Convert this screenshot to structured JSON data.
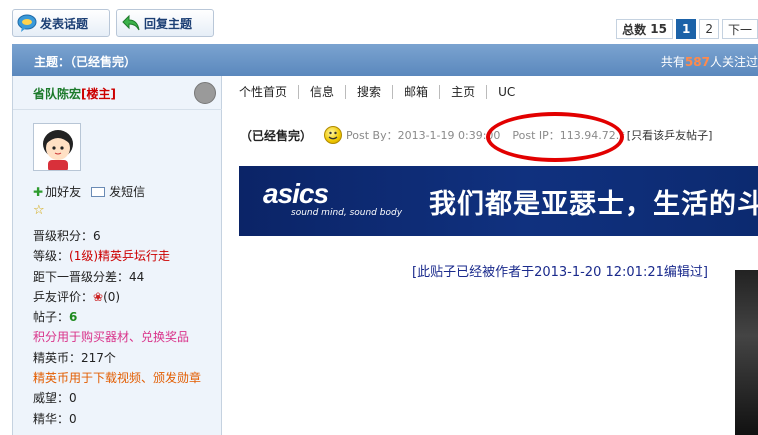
{
  "toolbar": {
    "new_topic": "发表话题",
    "reply_topic": "回复主题"
  },
  "pager": {
    "total_label": "总数",
    "total_count": "15",
    "pages": [
      "1",
      "2"
    ],
    "current": "1",
    "next": "下一"
  },
  "topic": {
    "title": "主题：（已经售完）",
    "followers_prefix": "共有",
    "followers_count": "587",
    "followers_suffix": "人关注过"
  },
  "author": {
    "name": "省队陈宏",
    "role": "[楼主]",
    "add_friend": "加好友",
    "send_message": "发短信",
    "stats": [
      {
        "text": "晋级积分：6",
        "style": ""
      },
      {
        "text": "等级：",
        "value": "(1级)精英乒坛行走",
        "style": "red"
      },
      {
        "text": "距下一晋级分差：44",
        "style": ""
      },
      {
        "text": "乒友评价：",
        "value": "(0)",
        "style": "flower"
      },
      {
        "text": "帖子：",
        "value": "6",
        "style": "green"
      },
      {
        "text": "积分用于购买器材、兑换奖品",
        "style": "pink"
      },
      {
        "text": "精英币：217个",
        "style": ""
      },
      {
        "text": "精英币用于下载视频、颁发勋章",
        "style": "orange"
      },
      {
        "text": "威望：0",
        "style": ""
      },
      {
        "text": "精华：0",
        "style": ""
      }
    ]
  },
  "menu": [
    "个性首页",
    "信息",
    "搜索",
    "邮箱",
    "主页",
    "UC"
  ],
  "post": {
    "title": "（已经售完）",
    "post_by": "Post By：2013-1-19 0:39:00",
    "post_ip": "Post IP：113.94.72.*",
    "only_this": "[只看该乒友帖子]"
  },
  "banner": {
    "brand": "asics",
    "tagline": "sound mind, sound body",
    "slogan": "我们都是亚瑟士，生活的斗"
  },
  "edited_note": "[此贴子已经被作者于2013-1-20 12:01:21编辑过]",
  "colors": {
    "title_bar": "#6a96c8",
    "left_panel": "#eef4fb",
    "highlight_circle": "#e20000",
    "banner_bg": "#0b2467"
  }
}
